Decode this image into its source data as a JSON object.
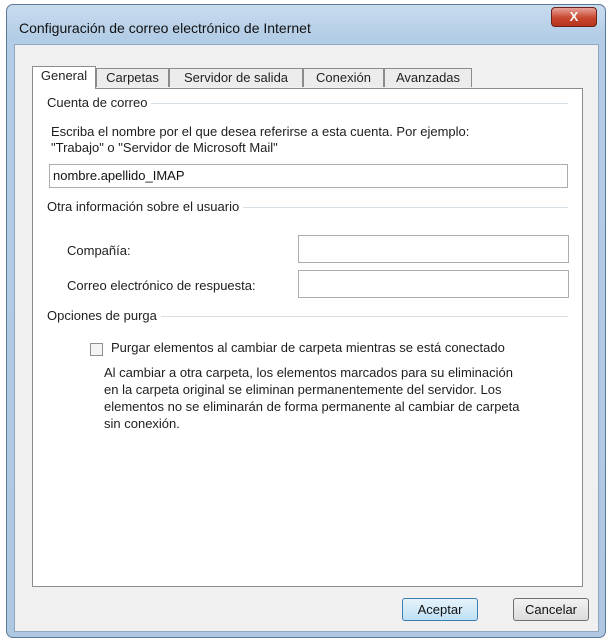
{
  "window": {
    "title": "Configuración de correo electrónico de Internet",
    "close_label": "X"
  },
  "tabs": [
    {
      "label": "General"
    },
    {
      "label": "Carpetas"
    },
    {
      "label": "Servidor de salida"
    },
    {
      "label": "Conexión"
    },
    {
      "label": "Avanzadas"
    }
  ],
  "account": {
    "group_label": "Cuenta de correo",
    "description_line1": "Escriba el nombre por el que desea referirse a esta cuenta. Por ejemplo:",
    "description_line2": "\"Trabajo\" o \"Servidor de Microsoft Mail\"",
    "name_value": "nombre.apellido_IMAP"
  },
  "user_info": {
    "group_label": "Otra información sobre el usuario",
    "company_label": "Compañía:",
    "company_value": "",
    "reply_label": "Correo electrónico de respuesta:",
    "reply_value": ""
  },
  "purge": {
    "group_label": "Opciones de purga",
    "checkbox_label": "Purgar elementos al cambiar de carpeta mientras se está conectado",
    "checked": false,
    "note_line1": "Al cambiar a otra carpeta, los elementos marcados para su eliminación",
    "note_line2": "en la carpeta original se eliminan permanentemente del servidor. Los",
    "note_line3": "elementos no se eliminarán de forma permanente al cambiar de carpeta",
    "note_line4": "sin conexión."
  },
  "buttons": {
    "ok": "Aceptar",
    "cancel": "Cancelar"
  }
}
